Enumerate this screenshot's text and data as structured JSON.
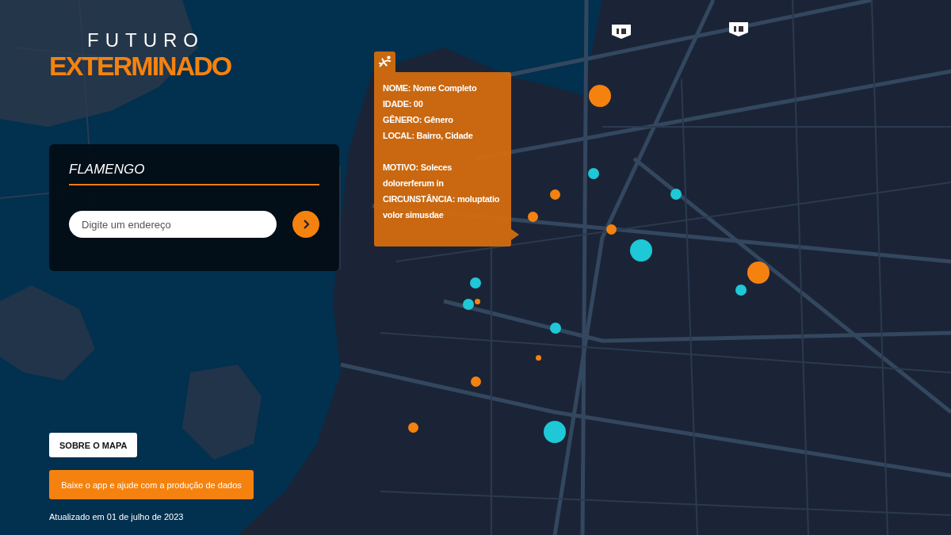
{
  "logo": {
    "line_1": "FUTURO",
    "line_2": "EXTERMINADO"
  },
  "search_panel": {
    "title": "FLAMENGO",
    "address_field": {
      "placeholder": "Digite um endereço"
    }
  },
  "tooltip": {
    "groups": [
      [
        "NOME: Nome Completo",
        "IDADE: 00",
        "GÊNERO: Gênero",
        "LOCAL: Bairro, Cidade"
      ],
      [
        "MOTIVO: Soleces dolorerferum in",
        "CIRCUNSTÂNCIA: moluptatio volor simusdae"
      ]
    ]
  },
  "markers": [
    {
      "color": "#f5820f",
      "kind": "large"
    },
    {
      "color": "#f5820f",
      "kind": "large"
    },
    {
      "color": "#f5820f",
      "kind": "medium"
    },
    {
      "color": "#f5820f",
      "kind": "medium"
    },
    {
      "color": "#f5820f",
      "kind": "medium"
    },
    {
      "color": "#f5820f",
      "kind": "medium"
    },
    {
      "color": "#f5820f",
      "kind": "medium"
    },
    {
      "color": "#f5820f",
      "kind": "small"
    },
    {
      "color": "#f5820f",
      "kind": "small"
    },
    {
      "color": "#1ec8d6",
      "kind": "medium"
    },
    {
      "color": "#1ec8d6",
      "kind": "medium"
    },
    {
      "color": "#1ec8d6",
      "kind": "medium"
    },
    {
      "color": "#1ec8d6",
      "kind": "medium"
    },
    {
      "color": "#1ec8d6",
      "kind": "medium"
    },
    {
      "color": "#1ec8d6",
      "kind": "medium"
    },
    {
      "color": "#1ec8d6",
      "kind": "large"
    },
    {
      "color": "#1ec8d6",
      "kind": "large"
    }
  ],
  "about_button": "SOBRE O MAPA",
  "app_button": "Baixe o app e ajude com a produção de dados",
  "updated_note": "Atualizado em 01 de julho de 2023"
}
